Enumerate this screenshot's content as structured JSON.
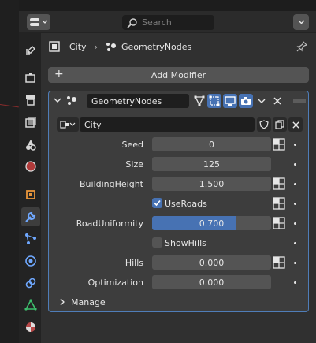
{
  "header": {
    "search_placeholder": "Search"
  },
  "breadcrumb": {
    "object": "City",
    "modifier": "GeometryNodes"
  },
  "add_modifier_label": "Add Modifier",
  "modifier": {
    "name": "GeometryNodes",
    "node_group": "City",
    "fields": [
      {
        "label": "Seed",
        "value": "0"
      },
      {
        "label": "Size",
        "value": "125"
      },
      {
        "label": "BuildingHeight",
        "value": "1.500"
      },
      {
        "label": "RoadUniformity",
        "value": "0.700",
        "fraction": 0.7
      },
      {
        "label": "Hills",
        "value": "0.000"
      },
      {
        "label": "Optimization",
        "value": "0.000"
      }
    ],
    "checkboxes": [
      {
        "label": "UseRoads",
        "checked": true
      },
      {
        "label": "ShowHills",
        "checked": false
      }
    ],
    "manage_label": "Manage"
  },
  "tabs": [
    "tool-icon",
    "render-icon",
    "output-icon",
    "view-layer-icon",
    "scene-icon",
    "world-icon",
    "object-icon",
    "modifier-icon",
    "particles-icon",
    "physics-icon",
    "constraints-icon",
    "data-icon",
    "material-icon"
  ],
  "colors": {
    "accent": "#4772b3",
    "panel_border": "#4f7db8"
  }
}
